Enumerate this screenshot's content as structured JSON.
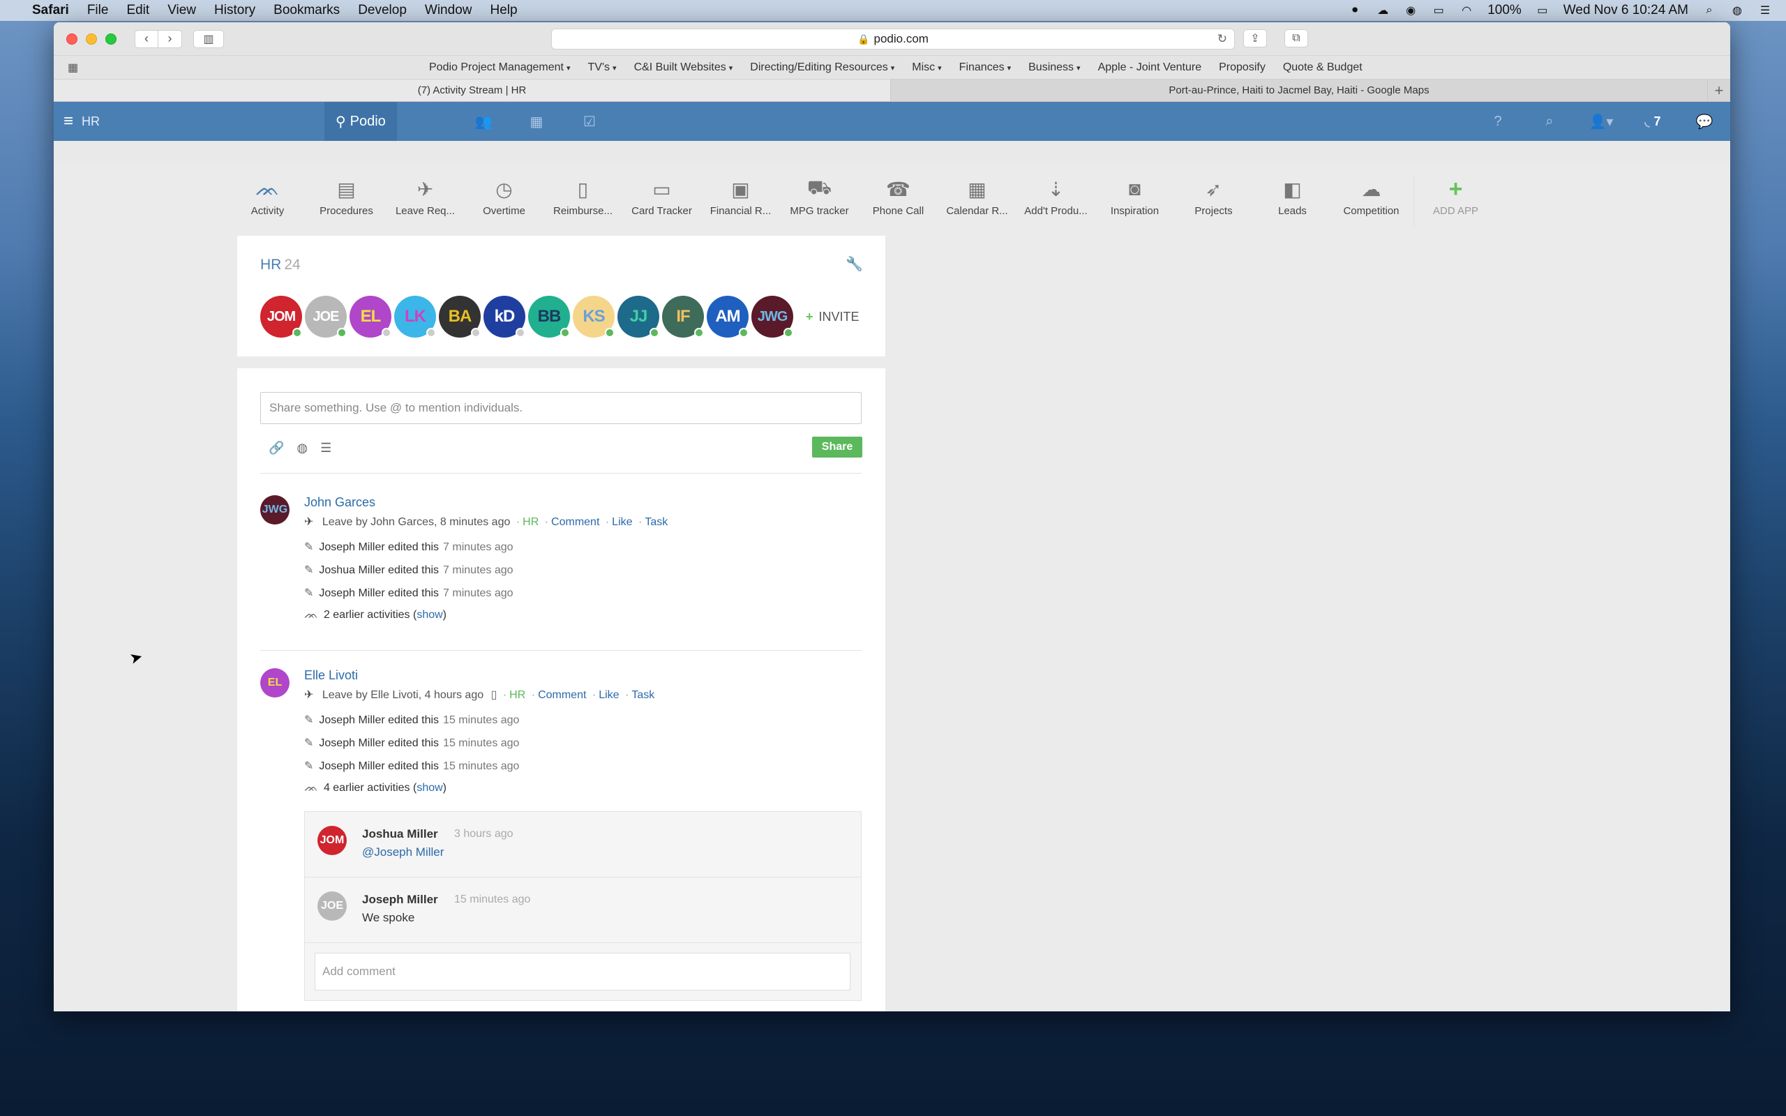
{
  "menubar": {
    "apple": "",
    "items": [
      "Safari",
      "File",
      "Edit",
      "View",
      "History",
      "Bookmarks",
      "Develop",
      "Window",
      "Help"
    ],
    "battery": "100%",
    "datetime": "Wed Nov 6  10:24 AM"
  },
  "browser": {
    "url": "podio.com",
    "bookmarks": [
      {
        "label": "Podio Project Management",
        "dropdown": true
      },
      {
        "label": "TV's",
        "dropdown": true
      },
      {
        "label": "C&I Built Websites",
        "dropdown": true
      },
      {
        "label": "Directing/Editing Resources",
        "dropdown": true
      },
      {
        "label": "Misc",
        "dropdown": true
      },
      {
        "label": "Finances",
        "dropdown": true
      },
      {
        "label": "Business",
        "dropdown": true
      },
      {
        "label": "Apple - Joint Venture",
        "dropdown": false
      },
      {
        "label": "Proposify",
        "dropdown": false
      },
      {
        "label": "Quote & Budget",
        "dropdown": false
      }
    ],
    "tabs": [
      "(7) Activity Stream | HR",
      "Port-au-Prince, Haiti to Jacmel Bay, Haiti - Google Maps"
    ]
  },
  "podio": {
    "workspace": "HR",
    "brand": "Podio",
    "feed_count": "7",
    "apps": [
      {
        "label": "Activity",
        "icon": "activity-icon",
        "glyph": "ᨏ"
      },
      {
        "label": "Procedures",
        "icon": "document-icon",
        "glyph": "▤"
      },
      {
        "label": "Leave Req...",
        "icon": "plane-icon",
        "glyph": "✈"
      },
      {
        "label": "Overtime",
        "icon": "clock-icon",
        "glyph": "◷"
      },
      {
        "label": "Reimburse...",
        "icon": "receipt-icon",
        "glyph": "▯"
      },
      {
        "label": "Card Tracker",
        "icon": "credit-card-icon",
        "glyph": "▭"
      },
      {
        "label": "Financial R...",
        "icon": "money-icon",
        "glyph": "▣"
      },
      {
        "label": "MPG tracker",
        "icon": "car-icon",
        "glyph": "⛟"
      },
      {
        "label": "Phone Call",
        "icon": "phone-icon",
        "glyph": "☎"
      },
      {
        "label": "Calendar R...",
        "icon": "calendar-icon",
        "glyph": "▦"
      },
      {
        "label": "Add't Produ...",
        "icon": "arrows-icon",
        "glyph": "⇣"
      },
      {
        "label": "Inspiration",
        "icon": "camera-icon",
        "glyph": "◙"
      },
      {
        "label": "Projects",
        "icon": "rocket-icon",
        "glyph": "➶"
      },
      {
        "label": "Leads",
        "icon": "contacts-icon",
        "glyph": "◧"
      },
      {
        "label": "Competition",
        "icon": "cloud-icon",
        "glyph": "☁"
      }
    ],
    "add_app": "ADD APP",
    "workspace_card": {
      "title": "HR",
      "member_count": "24",
      "members": [
        {
          "initials": "JOM",
          "bg": "#d0242e",
          "fg": "#ffffff",
          "status": "#5cb85c"
        },
        {
          "initials": "JOE",
          "bg": "#b8b8b8",
          "fg": "#ffffff",
          "status": "#5cb85c"
        },
        {
          "initials": "EL",
          "bg": "#b046c9",
          "fg": "#f0e040",
          "status": "#cccccc"
        },
        {
          "initials": "LK",
          "bg": "#3cb6e8",
          "fg": "#d040c0",
          "status": "#cccccc"
        },
        {
          "initials": "BA",
          "bg": "#333333",
          "fg": "#e8c020",
          "status": "#cccccc"
        },
        {
          "initials": "kD",
          "bg": "#1f3fa0",
          "fg": "#ffffff",
          "status": "#cccccc"
        },
        {
          "initials": "BB",
          "bg": "#20b090",
          "fg": "#1b3a60",
          "status": "#5cb85c"
        },
        {
          "initials": "KS",
          "bg": "#f4d58a",
          "fg": "#6aa0d8",
          "status": "#5cb85c"
        },
        {
          "initials": "JJ",
          "bg": "#1e6a8a",
          "fg": "#40d0a0",
          "status": "#5cb85c"
        },
        {
          "initials": "IF",
          "bg": "#3f6b5b",
          "fg": "#f0c060",
          "status": "#5cb85c"
        },
        {
          "initials": "AM",
          "bg": "#1f5fc0",
          "fg": "#ffffff",
          "status": "#5cb85c"
        },
        {
          "initials": "JWG",
          "bg": "#5a1a2a",
          "fg": "#70b8e8",
          "status": "#5cb85c"
        }
      ],
      "invite": "INVITE"
    },
    "share": {
      "placeholder": "Share something. Use @ to mention individuals.",
      "button": "Share"
    },
    "posts": [
      {
        "author": "John Garces",
        "avatar": {
          "initials": "JWG",
          "bg": "#5a1a2a",
          "fg": "#70b8e8"
        },
        "meta": {
          "app": "Leave",
          "by": "by John Garces, 8 minutes ago",
          "space": "HR",
          "comment": "Comment",
          "like": "Like",
          "task": "Task"
        },
        "activities": [
          {
            "text": "Joseph Miller edited this",
            "time": "7 minutes ago"
          },
          {
            "text": "Joshua Miller edited this",
            "time": "7 minutes ago"
          },
          {
            "text": "Joseph Miller edited this",
            "time": "7 minutes ago"
          }
        ],
        "earlier": {
          "text": "2 earlier activities (",
          "link": "show",
          "close": ")"
        }
      },
      {
        "author": "Elle Livoti",
        "avatar": {
          "initials": "EL",
          "bg": "#b046c9",
          "fg": "#f0e040"
        },
        "meta": {
          "app": "Leave",
          "by": "by Elle Livoti, 4 hours ago",
          "space": "HR",
          "comment": "Comment",
          "like": "Like",
          "task": "Task"
        },
        "activities": [
          {
            "text": "Joseph Miller edited this",
            "time": "15 minutes ago"
          },
          {
            "text": "Joseph Miller edited this",
            "time": "15 minutes ago"
          },
          {
            "text": "Joseph Miller edited this",
            "time": "15 minutes ago"
          }
        ],
        "earlier": {
          "text": "4 earlier activities (",
          "link": "show",
          "close": ")"
        },
        "comments": [
          {
            "author": "Joshua Miller",
            "time": "3 hours ago",
            "text": "@Joseph Miller",
            "mention": true,
            "avatar": {
              "initials": "JOM",
              "bg": "#d0242e",
              "fg": "#ffffff"
            }
          },
          {
            "author": "Joseph Miller",
            "time": "15 minutes ago",
            "text": "We spoke",
            "mention": false,
            "avatar": {
              "initials": "JOE",
              "bg": "#b8b8b8",
              "fg": "#ffffff"
            }
          }
        ],
        "add_comment_placeholder": "Add comment"
      }
    ]
  }
}
